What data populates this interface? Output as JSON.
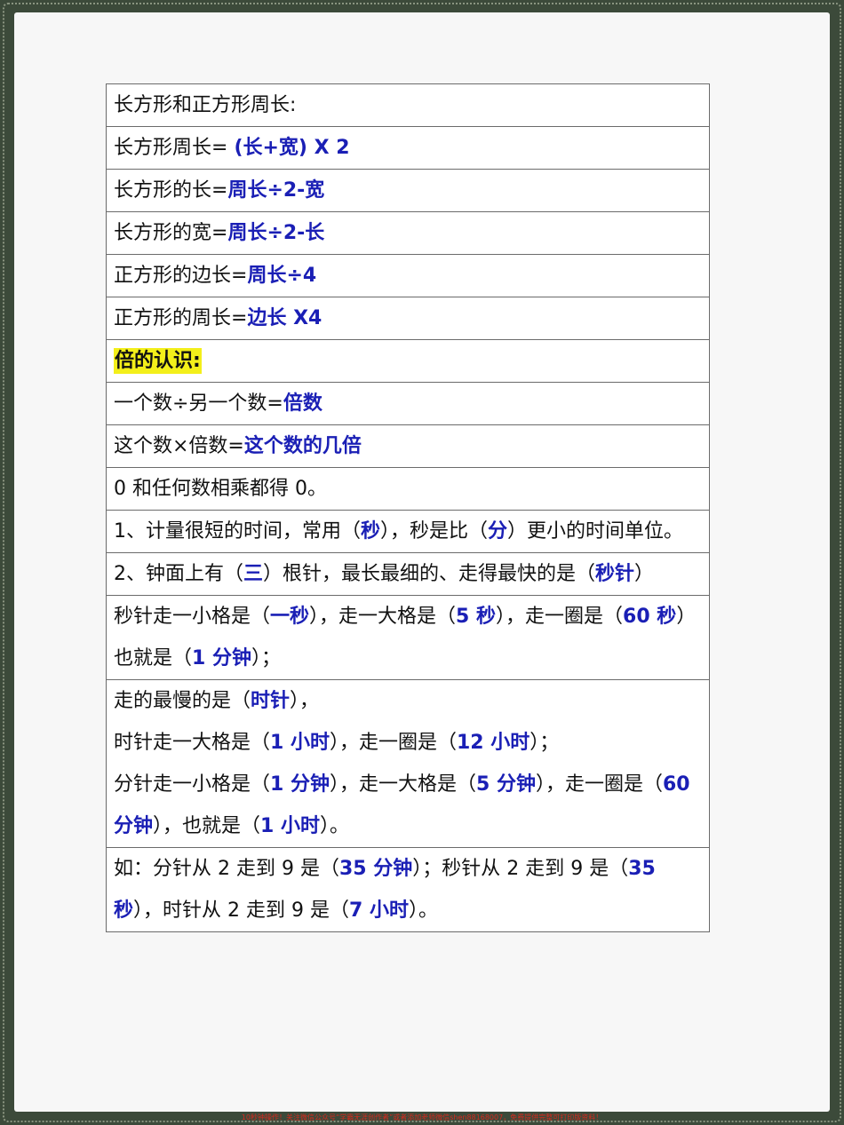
{
  "rows": [
    {
      "id": "perimeter-heading",
      "parts": [
        {
          "t": "长方形和正方形周长:"
        }
      ]
    },
    {
      "id": "rect-perimeter",
      "parts": [
        {
          "t": "长方形周长= "
        },
        {
          "t": "(长+宽) X 2",
          "b": true
        }
      ]
    },
    {
      "id": "rect-length",
      "parts": [
        {
          "t": "长方形的长="
        },
        {
          "t": "周长÷2-宽",
          "b": true
        }
      ]
    },
    {
      "id": "rect-width",
      "parts": [
        {
          "t": "长方形的宽="
        },
        {
          "t": "周长÷2-长",
          "b": true
        }
      ]
    },
    {
      "id": "square-side",
      "parts": [
        {
          "t": "正方形的边长="
        },
        {
          "t": "周长÷4",
          "b": true
        }
      ]
    },
    {
      "id": "square-perimeter",
      "parts": [
        {
          "t": "正方形的周长="
        },
        {
          "t": "边长 X4",
          "b": true
        }
      ]
    },
    {
      "id": "multiples-heading",
      "parts": [
        {
          "t": "倍的认识:",
          "hl": true
        }
      ]
    },
    {
      "id": "multiple-division",
      "parts": [
        {
          "t": "一个数÷另一个数="
        },
        {
          "t": "倍数",
          "b": true
        }
      ]
    },
    {
      "id": "multiple-product",
      "parts": [
        {
          "t": "这个数×倍数="
        },
        {
          "t": "这个数的几倍",
          "b": true
        }
      ]
    },
    {
      "id": "zero-rule",
      "parts": [
        {
          "t": "0 和任何数相乘都得 0。"
        }
      ]
    },
    {
      "id": "time-unit-second",
      "parts": [
        {
          "t": "1、计量很短的时间，常用（"
        },
        {
          "t": "秒",
          "b": true
        },
        {
          "t": "），秒是比（"
        },
        {
          "t": "分",
          "b": true
        },
        {
          "t": "）更小的时间单位。"
        }
      ]
    },
    {
      "id": "clock-hands",
      "parts": [
        {
          "t": "2、钟面上有（"
        },
        {
          "t": "三",
          "b": true
        },
        {
          "t": "）根针，最长最细的、走得最快的是（"
        },
        {
          "t": "秒针",
          "b": true
        },
        {
          "t": "）"
        }
      ]
    },
    {
      "id": "second-hand",
      "parts": [
        {
          "t": "秒针走一小格是（"
        },
        {
          "t": "一秒",
          "b": true
        },
        {
          "t": "），走一大格是（"
        },
        {
          "t": "5 秒",
          "b": true
        },
        {
          "t": "），走一圈是（"
        },
        {
          "t": "60 秒",
          "b": true
        },
        {
          "t": "）也就是（"
        },
        {
          "t": "1 分钟",
          "b": true
        },
        {
          "t": "）；"
        }
      ]
    },
    {
      "id": "slowest-hand",
      "lines": [
        [
          {
            "t": "走的最慢的是（"
          },
          {
            "t": "时针",
            "b": true
          },
          {
            "t": "），"
          }
        ],
        [
          {
            "t": "时针走一大格是（"
          },
          {
            "t": "1 小时",
            "b": true
          },
          {
            "t": "），走一圈是（"
          },
          {
            "t": "12 小时",
            "b": true
          },
          {
            "t": "）；"
          }
        ],
        [
          {
            "t": "分针走一小格是（"
          },
          {
            "t": "1 分钟",
            "b": true
          },
          {
            "t": "），走一大格是（"
          },
          {
            "t": "5 分钟",
            "b": true
          },
          {
            "t": "），走一圈是（"
          },
          {
            "t": "60 分钟",
            "b": true
          },
          {
            "t": "），也就是（"
          },
          {
            "t": "1 小时",
            "b": true
          },
          {
            "t": "）。"
          }
        ]
      ]
    },
    {
      "id": "example",
      "parts": [
        {
          "t": "如：分针从 2 走到 9 是（"
        },
        {
          "t": "35 分钟",
          "b": true
        },
        {
          "t": "）；秒针从 2 走到 9 是（"
        },
        {
          "t": "35 秒",
          "b": true
        },
        {
          "t": "），时针从 2 走到 9 是（"
        },
        {
          "t": "7 小时",
          "b": true
        },
        {
          "t": "）。"
        }
      ]
    }
  ],
  "footer": "10秒钟操作！关注微信公众号“学霸无涯创作者”或者添加老师微信shen88168007，免费提供完整可打印版资料！",
  "colors": {
    "answer": "#1a1fb5",
    "highlight": "#f3ef1a",
    "footer": "#d62a1e"
  }
}
